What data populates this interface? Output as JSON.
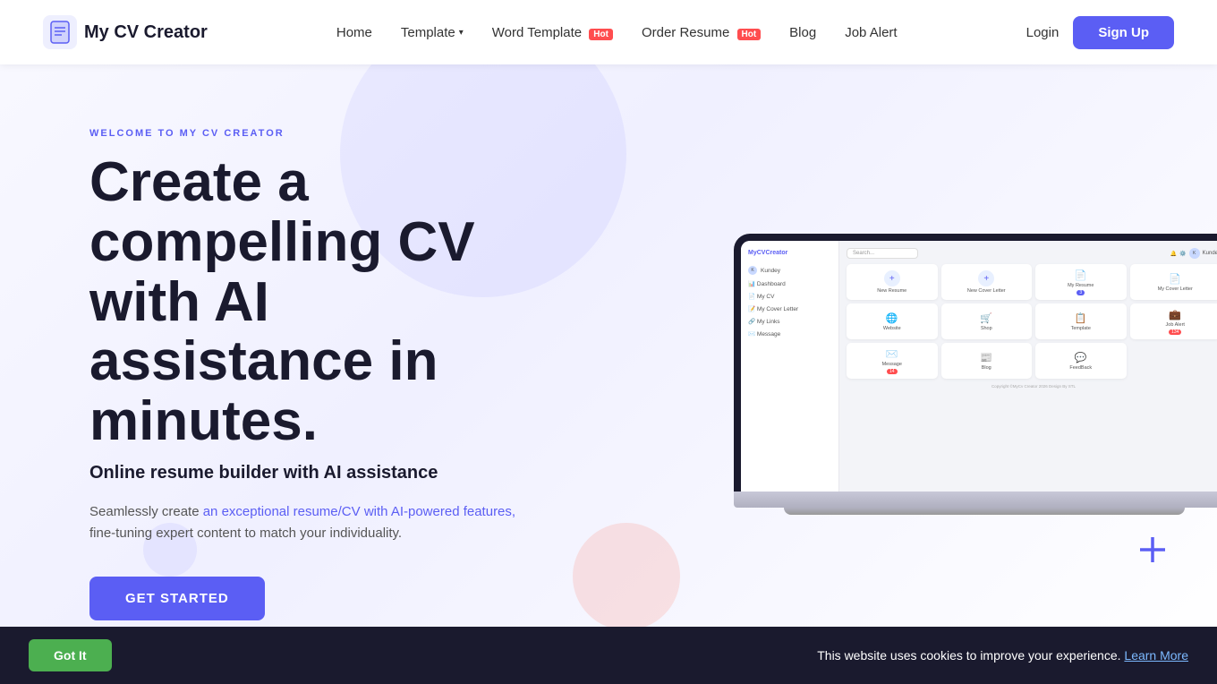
{
  "nav": {
    "logo_text": "My CV Creator",
    "links": [
      {
        "label": "Home",
        "name": "home"
      },
      {
        "label": "Template",
        "name": "template",
        "has_dropdown": true
      },
      {
        "label": "Word Template",
        "name": "word-template",
        "badge": "Hot"
      },
      {
        "label": "Order Resume",
        "name": "order-resume",
        "badge": "Hot"
      },
      {
        "label": "Blog",
        "name": "blog"
      },
      {
        "label": "Job Alert",
        "name": "job-alert"
      }
    ],
    "login_label": "Login",
    "signup_label": "Sign Up"
  },
  "hero": {
    "tag": "WELCOME TO MY CV CREATOR",
    "title": "Create a compelling CV with AI assistance in minutes.",
    "subtitle": "Online resume builder with AI assistance",
    "desc_plain": "Seamlessly create ",
    "desc_link": "an exceptional resume/CV with AI-powered features,",
    "desc_after": "\nfine-tuning expert content to match your individuality.",
    "cta_label": "GET STARTED"
  },
  "mockup": {
    "logo": "MyCVCreator",
    "search_placeholder": "Search",
    "sidebar_items": [
      {
        "label": "Kundey",
        "active": false
      },
      {
        "label": "Dashboard",
        "active": false
      },
      {
        "label": "My CV",
        "active": false
      },
      {
        "label": "My Cover Letter",
        "active": false
      },
      {
        "label": "My Links",
        "active": false
      },
      {
        "label": "Message",
        "active": false
      }
    ],
    "cards": [
      {
        "icon": "➕",
        "label": "New Resume",
        "badge": null,
        "badge_type": null
      },
      {
        "icon": "➕",
        "label": "New Cover Letter",
        "badge": null,
        "badge_type": null
      },
      {
        "icon": "📄",
        "label": "My Resume",
        "badge": "3",
        "badge_type": "blue"
      },
      {
        "icon": "📄",
        "label": "My Cover Letter",
        "badge": null,
        "badge_type": null
      },
      {
        "icon": "🌐",
        "label": "Website",
        "badge": null,
        "badge_type": null
      },
      {
        "icon": "🛒",
        "label": "Shop",
        "badge": null,
        "badge_type": null
      },
      {
        "icon": "📋",
        "label": "Template",
        "badge": null,
        "badge_type": null
      },
      {
        "icon": "💼",
        "label": "Job Alert",
        "badge": "134",
        "badge_type": "red"
      },
      {
        "icon": "✉️",
        "label": "Message",
        "badge": "14",
        "badge_type": "red"
      },
      {
        "icon": "📝",
        "label": "Blog",
        "badge": null,
        "badge_type": null
      },
      {
        "icon": "💬",
        "label": "Feedback",
        "badge": null,
        "badge_type": null
      }
    ]
  },
  "cookie": {
    "got_it_label": "Got It",
    "message": "This website uses cookies to improve your experience.",
    "learn_more_label": "Learn More"
  }
}
